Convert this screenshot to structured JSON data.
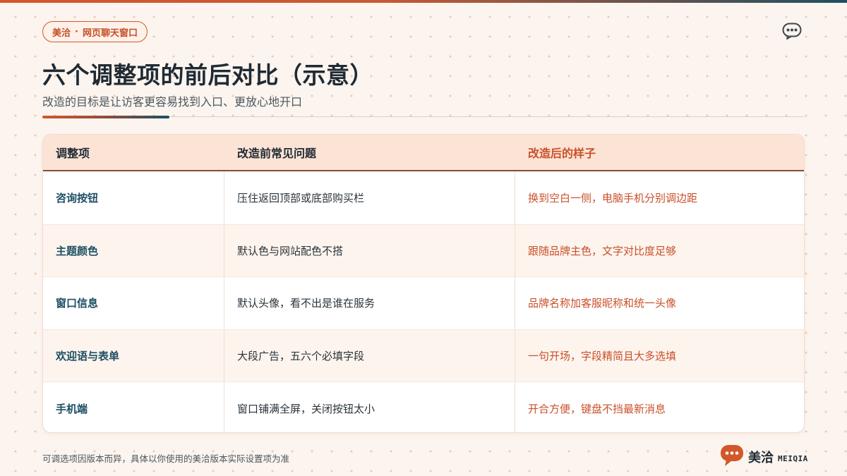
{
  "header": {
    "brand_pill": {
      "brand": "美洽",
      "separator": "·",
      "label": "网页聊天窗口"
    },
    "title": "六个调整项的前后对比（示意）",
    "subtitle": "改造的目标是让访客更容易找到入口、更放心地开口",
    "menu_icon": "chat-bubble-dots-icon"
  },
  "table": {
    "headers": [
      "调整项",
      "改造前常见问题",
      "改造后的样子"
    ],
    "rows": [
      {
        "item": "咨询按钮",
        "before": "压住返回顶部或底部购买栏",
        "after": "换到空白一侧，电脑手机分别调边距"
      },
      {
        "item": "主题颜色",
        "before": "默认色与网站配色不搭",
        "after": "跟随品牌主色，文字对比度足够"
      },
      {
        "item": "窗口信息",
        "before": "默认头像，看不出是谁在服务",
        "after": "品牌名称加客服昵称和统一头像"
      },
      {
        "item": "欢迎语与表单",
        "before": "大段广告，五六个必填字段",
        "after": "一句开场，字段精简且大多选填"
      },
      {
        "item": "手机端",
        "before": "窗口铺满全屏，关闭按钮太小",
        "after": "开合方便，键盘不挡最新消息"
      }
    ]
  },
  "footer": {
    "note": "可调选项因版本而异，具体以你使用的美洽版本实际设置项为准",
    "logo_name": "美洽",
    "logo_latin": "MEIQIA",
    "logo_icon": "chat-bubble-logo-icon"
  },
  "colors": {
    "accent": "#d2582c",
    "accent_text": "#c9502a",
    "navy": "#1d4f63",
    "background": "#fcf4ee",
    "header_row": "#fbe3d6"
  }
}
